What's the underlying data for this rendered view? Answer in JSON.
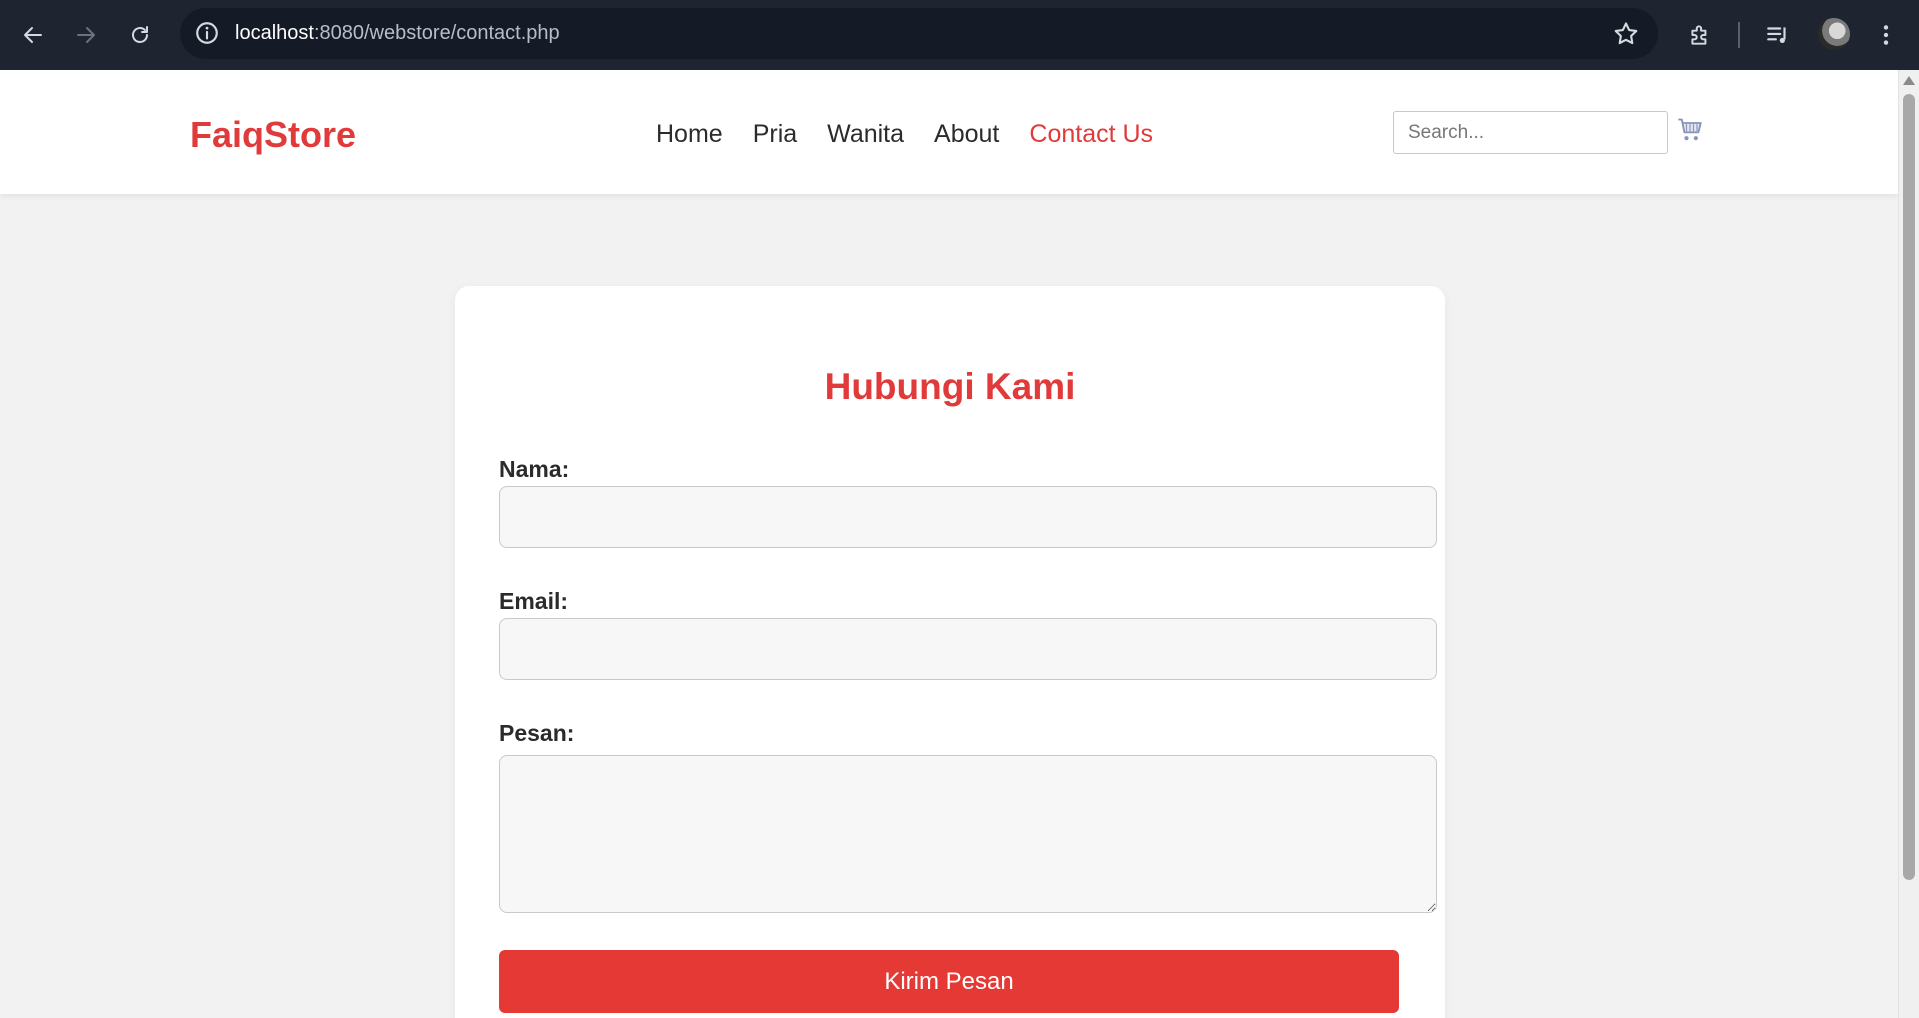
{
  "browser": {
    "url_host": "localhost",
    "url_rest": ":8080/webstore/contact.php"
  },
  "site": {
    "logo": "FaiqStore",
    "nav": [
      {
        "label": "Home",
        "active": false
      },
      {
        "label": "Pria",
        "active": false
      },
      {
        "label": "Wanita",
        "active": false
      },
      {
        "label": "About",
        "active": false
      },
      {
        "label": "Contact Us",
        "active": true
      }
    ],
    "search_placeholder": "Search...",
    "accent_color": "#e03a3a"
  },
  "contact": {
    "title": "Hubungi Kami",
    "name_label": "Nama:",
    "email_label": "Email:",
    "message_label": "Pesan:",
    "submit_label": "Kirim Pesan"
  }
}
